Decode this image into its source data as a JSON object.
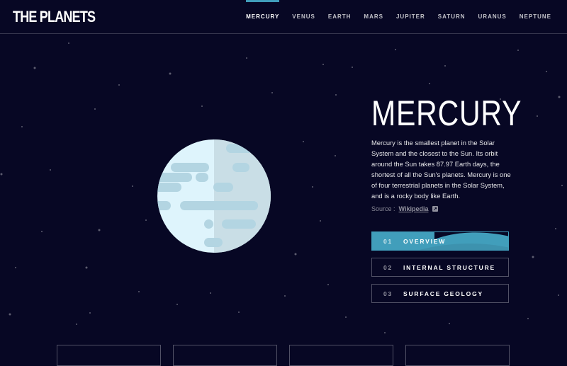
{
  "brand": "THE PLANETS",
  "nav": [
    {
      "label": "MERCURY",
      "active": true
    },
    {
      "label": "VENUS"
    },
    {
      "label": "EARTH"
    },
    {
      "label": "MARS"
    },
    {
      "label": "JUPITER"
    },
    {
      "label": "SATURN"
    },
    {
      "label": "URANUS"
    },
    {
      "label": "NEPTUNE"
    }
  ],
  "planet": {
    "name": "MERCURY",
    "description": "Mercury is the smallest planet in the Solar System and the closest to the Sun. Its orbit around the Sun takes 87.97 Earth days, the shortest of all the Sun's planets. Mercury is one of four terrestrial planets in the Solar System, and is a rocky body like Earth.",
    "source_label": "Source :",
    "source_link": "Wikipedia"
  },
  "tabs": [
    {
      "num": "01",
      "label": "OVERVIEW",
      "active": true
    },
    {
      "num": "02",
      "label": "INTERNAL STRUCTURE"
    },
    {
      "num": "03",
      "label": "SURFACE GEOLOGY"
    }
  ],
  "colors": {
    "background": "#070724",
    "accent": "#419EBB",
    "planet_light": "#DEF4FC",
    "planet_dark": "#B3D5E2",
    "planet_shade": "#A6C5D3"
  },
  "icons": {
    "source": "external-link-icon"
  }
}
